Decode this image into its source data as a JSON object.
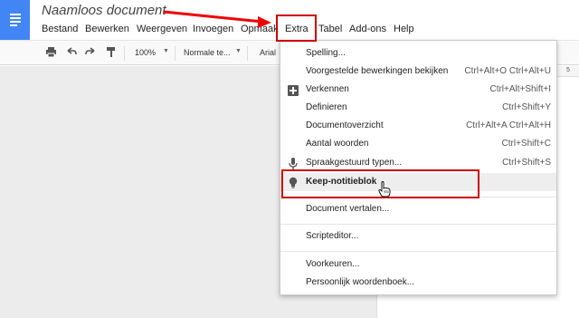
{
  "header": {
    "doc_title": "Naamloos document",
    "menus": [
      "Bestand",
      "Bewerken",
      "Weergeven",
      "Invoegen",
      "Opmaak",
      "Extra",
      "Tabel",
      "Add-ons",
      "Help"
    ]
  },
  "toolbar": {
    "zoom": "100%",
    "style": "Normale te...",
    "font": "Arial"
  },
  "ruler": {
    "mark": "5"
  },
  "dropdown": {
    "items": [
      {
        "label": "Spelling...",
        "shortcut": ""
      },
      {
        "label": "Voorgestelde bewerkingen bekijken",
        "shortcut": "Ctrl+Alt+O Ctrl+Alt+U"
      },
      {
        "label": "Verkennen",
        "shortcut": "Ctrl+Alt+Shift+I",
        "icon": "explore-plus-icon"
      },
      {
        "label": "Definieren",
        "shortcut": "Ctrl+Shift+Y"
      },
      {
        "label": "Documentoverzicht",
        "shortcut": "Ctrl+Alt+A Ctrl+Alt+H"
      },
      {
        "label": "Aantal woorden",
        "shortcut": "Ctrl+Shift+C"
      },
      {
        "label": "Spraakgestuurd typen...",
        "shortcut": "Ctrl+Shift+S",
        "icon": "microphone-icon"
      },
      {
        "label": "Keep-notitieblok",
        "shortcut": "",
        "icon": "lightbulb-icon"
      },
      {
        "label": "Document vertalen...",
        "shortcut": ""
      },
      {
        "label": "Scripteditor...",
        "shortcut": ""
      },
      {
        "label": "Voorkeuren...",
        "shortcut": ""
      },
      {
        "label": "Persoonlijk woordenboek...",
        "shortcut": ""
      }
    ]
  },
  "colors": {
    "brand": "#4285f4",
    "annotation_red": "#cc0000",
    "hover": "#eeeeee"
  }
}
